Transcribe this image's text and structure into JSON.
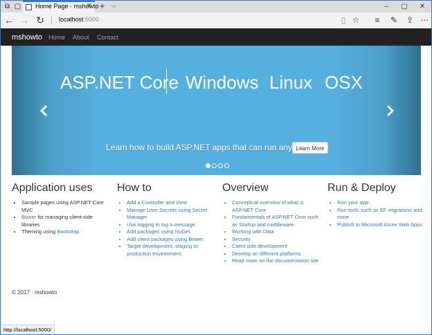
{
  "browser": {
    "tab_title": "Home Page - mshowto",
    "url_host": "localhost",
    "url_port": ":5000",
    "status_url": "http://localhost:5000/"
  },
  "nav": {
    "brand": "mshowto",
    "links": [
      "Home",
      "About",
      "Contact"
    ]
  },
  "carousel": {
    "brand": "ASP.NET Core",
    "platforms": [
      "Windows",
      "Linux",
      "OSX"
    ],
    "caption": "Learn how to build ASP.NET apps that can run anywhere.",
    "button": "Learn More"
  },
  "columns": [
    {
      "title": "Application uses",
      "items": [
        {
          "pre": "Sample pages using ASP.NET Core MVC",
          "link": "",
          "post": ""
        },
        {
          "pre": "",
          "link": "Bower",
          "post": " for managing client-side libraries"
        },
        {
          "pre": "Theming using ",
          "link": "Bootstrap",
          "post": ""
        }
      ]
    },
    {
      "title": "How to",
      "items": [
        "Add a Controller and View",
        "Manage User Secrets using Secret Manager",
        "Use logging to log a message.",
        "Add packages using NuGet.",
        "Add client packages using Bower.",
        "Target development, staging or production environment."
      ]
    },
    {
      "title": "Overview",
      "items": [
        "Conceptual overview of what is ASP.NET Core",
        "Fundamentals of ASP.NET Core such as Startup and middleware.",
        "Working with Data",
        "Security",
        "Client side development",
        "Develop on different platforms",
        "Read more on the documentation site"
      ]
    },
    {
      "title": "Run & Deploy",
      "items": [
        "Run your app",
        "Run tools such as EF migrations and more",
        "Publish to Microsoft Azure Web Apps"
      ]
    }
  ],
  "footer": "© 2017 - mshowto",
  "colors": {
    "link": "#337ab7",
    "navbar": "#222222",
    "carousel": "#56b0df",
    "accent": "#2e7bd6"
  }
}
